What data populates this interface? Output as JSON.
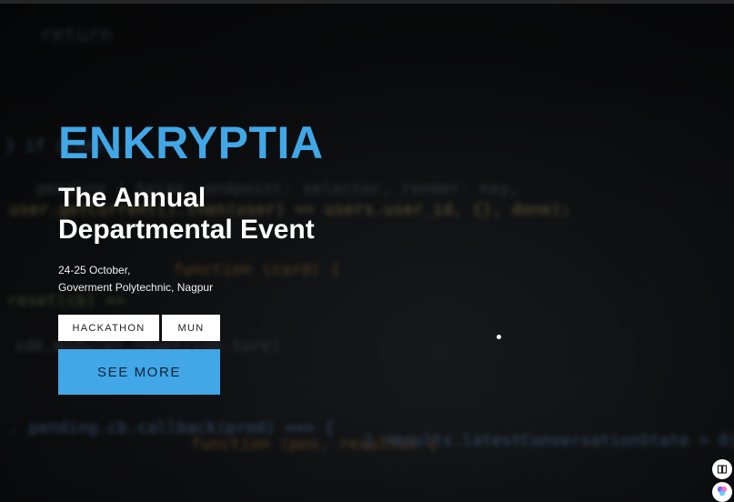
{
  "hero": {
    "brand": "ENKRYPTIA",
    "headline": "The Annual Departmental Event",
    "date": "24-25 October,",
    "venue": "Goverment Polytechnic, Nagpur",
    "tags": [
      {
        "label": "HACKATHON"
      },
      {
        "label": "MUN"
      }
    ],
    "cta_label": "SEE MORE"
  },
  "background_code": [
    "return",
    "} if (code) {",
    "pending ( $ajax, endpoint: selector, render: key,",
    "user.getCurrent().then(user) => users.user_id, {}, done);",
    "function (card) {",
    "reset(cb) =>",
    "sdk.modules.reset(ing.ture)",
    ". pending.cb.callback(prod) ==> {",
    "function (pos, results) {",
    "} results.latestConversationState > 0) {"
  ],
  "floating_icons": [
    "reader-icon",
    "assistant-icon"
  ],
  "colors": {
    "accent": "#41a7e6",
    "background": "#0d0e10",
    "tag_bg": "#ffffff"
  }
}
